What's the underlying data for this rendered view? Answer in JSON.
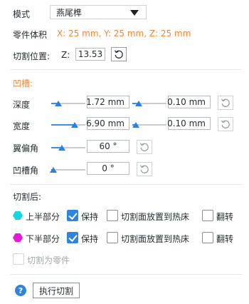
{
  "mode": {
    "label": "模式",
    "value": "燕尾榫"
  },
  "part_volume": {
    "label": "零件体积",
    "value": "X: 25 mm,  Y: 25 mm,  Z: 25 mm"
  },
  "cut_position": {
    "label": "切割位置:",
    "axis": "Z:",
    "value": "13.53"
  },
  "groove": {
    "title": "凹槽:",
    "depth": {
      "label": "深度",
      "value": "1.72  mm",
      "tolerance": "0.10  mm",
      "slider_fraction": 0.25,
      "tol_fraction": 0.2
    },
    "width": {
      "label": "宽度",
      "value": "6.90  mm",
      "tolerance": "0.10  mm",
      "slider_fraction": 0.7,
      "tol_fraction": 0.1
    },
    "flap_angle": {
      "label": "翼偏角",
      "value": "60 °",
      "slider_fraction": 0.32
    },
    "groove_angle": {
      "label": "凹槽角",
      "value": "0 °",
      "slider_fraction": 0.05
    }
  },
  "after_cut": {
    "title": "切割后:",
    "upper": {
      "label": "上半部分",
      "color": "#16d6e0",
      "keep": "保持",
      "place_on_bed": "切割面放置到热床",
      "flip": "翻转",
      "keep_checked": true,
      "place_checked": false,
      "flip_checked": false
    },
    "lower": {
      "label": "下半部分",
      "color": "#e51ad8",
      "keep": "保持",
      "place_on_bed": "切割面放置到热床",
      "flip": "翻转",
      "keep_checked": true,
      "place_checked": false,
      "flip_checked": false
    },
    "cut_to_parts": {
      "label": "切割为零件",
      "checked": false
    }
  },
  "footer": {
    "help": "?",
    "perform_cut": "执行切割"
  }
}
